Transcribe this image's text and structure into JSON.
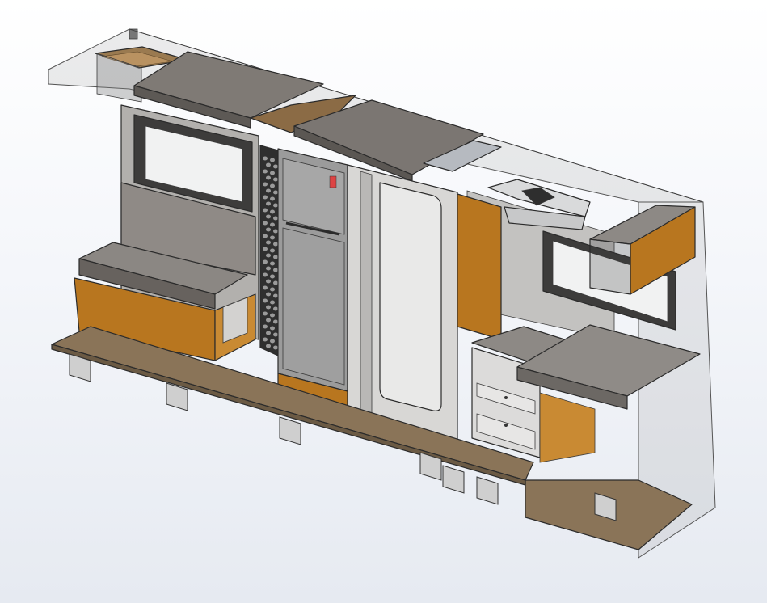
{
  "scene": {
    "background": "#eef1f6",
    "colors": {
      "wood": "#b8761f",
      "wood_light": "#c98a33",
      "floor_wood": "#8a7458",
      "panel_grey": "#8c8884",
      "panel_light": "#d8d7d5",
      "glass": "rgba(150,150,150,0.18)",
      "fridge": "#9b9b9b",
      "edge": "#2b2b2b"
    },
    "parts": [
      "roof-glass-panel",
      "overhead-shelf",
      "left-window",
      "bench-seat",
      "bench-storage-box",
      "ventilation-panel",
      "fridge",
      "shower-door",
      "counter-top",
      "sink-hob",
      "kitchen-drawers",
      "roof-air-conditioner",
      "right-window",
      "wall-cabinet",
      "table",
      "floor-board",
      "chassis-supports"
    ]
  }
}
